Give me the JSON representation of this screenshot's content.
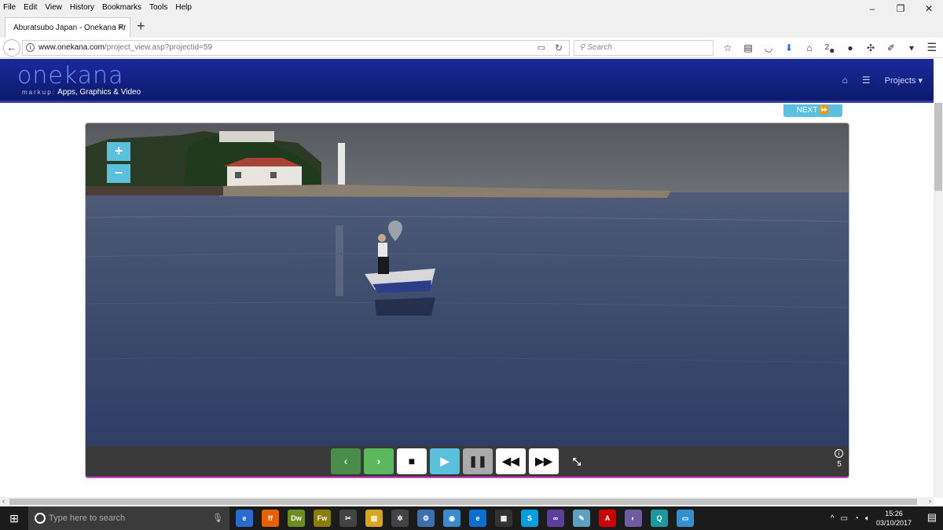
{
  "menubar": {
    "items": [
      "File",
      "Edit",
      "View",
      "History",
      "Bookmarks",
      "Tools",
      "Help"
    ]
  },
  "window_controls": {
    "minimize": "–",
    "restore": "❐",
    "close": "✕"
  },
  "tab": {
    "title": "Aburatsubo Japan - Onekana Pr",
    "close": "✕",
    "new_tab": "+"
  },
  "nav": {
    "url_host": "www.onekana.com",
    "url_path": "/project_view.asp?projectid=59",
    "search_placeholder": "Search",
    "downloads_badge": "2"
  },
  "site": {
    "brand": "onekana",
    "tagline_prefix": "markup:",
    "tagline": "Apps, Graphics & Video",
    "projects_label": "Projects ▾"
  },
  "viewer": {
    "next_label": "NEXT ⏩",
    "zoom_in": "+",
    "zoom_out": "−",
    "info_count": "5",
    "controls": {
      "prev": "‹",
      "next": "›",
      "stop": "■",
      "play": "▶",
      "pause": "❚❚",
      "rewind": "◀◀",
      "fast_forward": "▶▶",
      "shrink": "⤡"
    }
  },
  "taskbar": {
    "search_placeholder": "Type here to search",
    "time": "15:26",
    "date": "03/10/2017",
    "apps": [
      {
        "name": "edge-chromium",
        "label": "e",
        "color": "#2a6bd1"
      },
      {
        "name": "firefox",
        "label": "ff",
        "color": "#e66000"
      },
      {
        "name": "dreamweaver",
        "label": "Dw",
        "color": "#6b8e23"
      },
      {
        "name": "fireworks",
        "label": "Fw",
        "color": "#8b7d00"
      },
      {
        "name": "tools",
        "label": "✂",
        "color": "#444"
      },
      {
        "name": "explorer",
        "label": "▤",
        "color": "#d8a520"
      },
      {
        "name": "settings-app",
        "label": "✲",
        "color": "#444"
      },
      {
        "name": "gear-app",
        "label": "⚙",
        "color": "#3c6fb0"
      },
      {
        "name": "chrome-like",
        "label": "◉",
        "color": "#3a8ad0"
      },
      {
        "name": "edge",
        "label": "e",
        "color": "#0a6fd0"
      },
      {
        "name": "store",
        "label": "▦",
        "color": "#333"
      },
      {
        "name": "skype",
        "label": "S",
        "color": "#00a0e0"
      },
      {
        "name": "link-app",
        "label": "∞",
        "color": "#5a3fa0"
      },
      {
        "name": "notes-app",
        "label": "✎",
        "color": "#5aa0c0"
      },
      {
        "name": "acrobat",
        "label": "A",
        "color": "#c00"
      },
      {
        "name": "orb-app",
        "label": "◐",
        "color": "#705aa0"
      },
      {
        "name": "search-app",
        "label": "Q",
        "color": "#1a9aa0"
      },
      {
        "name": "remote-app",
        "label": "▭",
        "color": "#3090d0"
      }
    ]
  }
}
